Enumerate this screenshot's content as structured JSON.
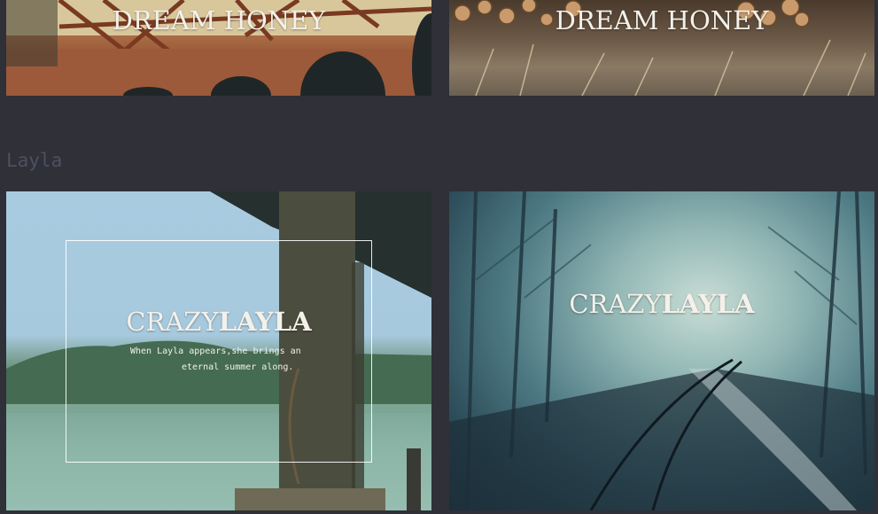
{
  "cards": {
    "bridge": {
      "title": "DREAM HONEY"
    },
    "logs": {
      "title": "DREAM HONEY"
    },
    "lake": {
      "title_light": "CRAZY",
      "title_bold": "LAYLA",
      "caption_line1": "When Layla appears,she brings an",
      "caption_line2": "eternal summer along."
    },
    "rail": {
      "title_light": "CRAZY",
      "title_bold": "LAYLA"
    }
  },
  "section": {
    "heading": "Layla"
  },
  "colors": {
    "background": "#2f3038",
    "heading": "#4d5060",
    "text": "#f4f1ea"
  }
}
